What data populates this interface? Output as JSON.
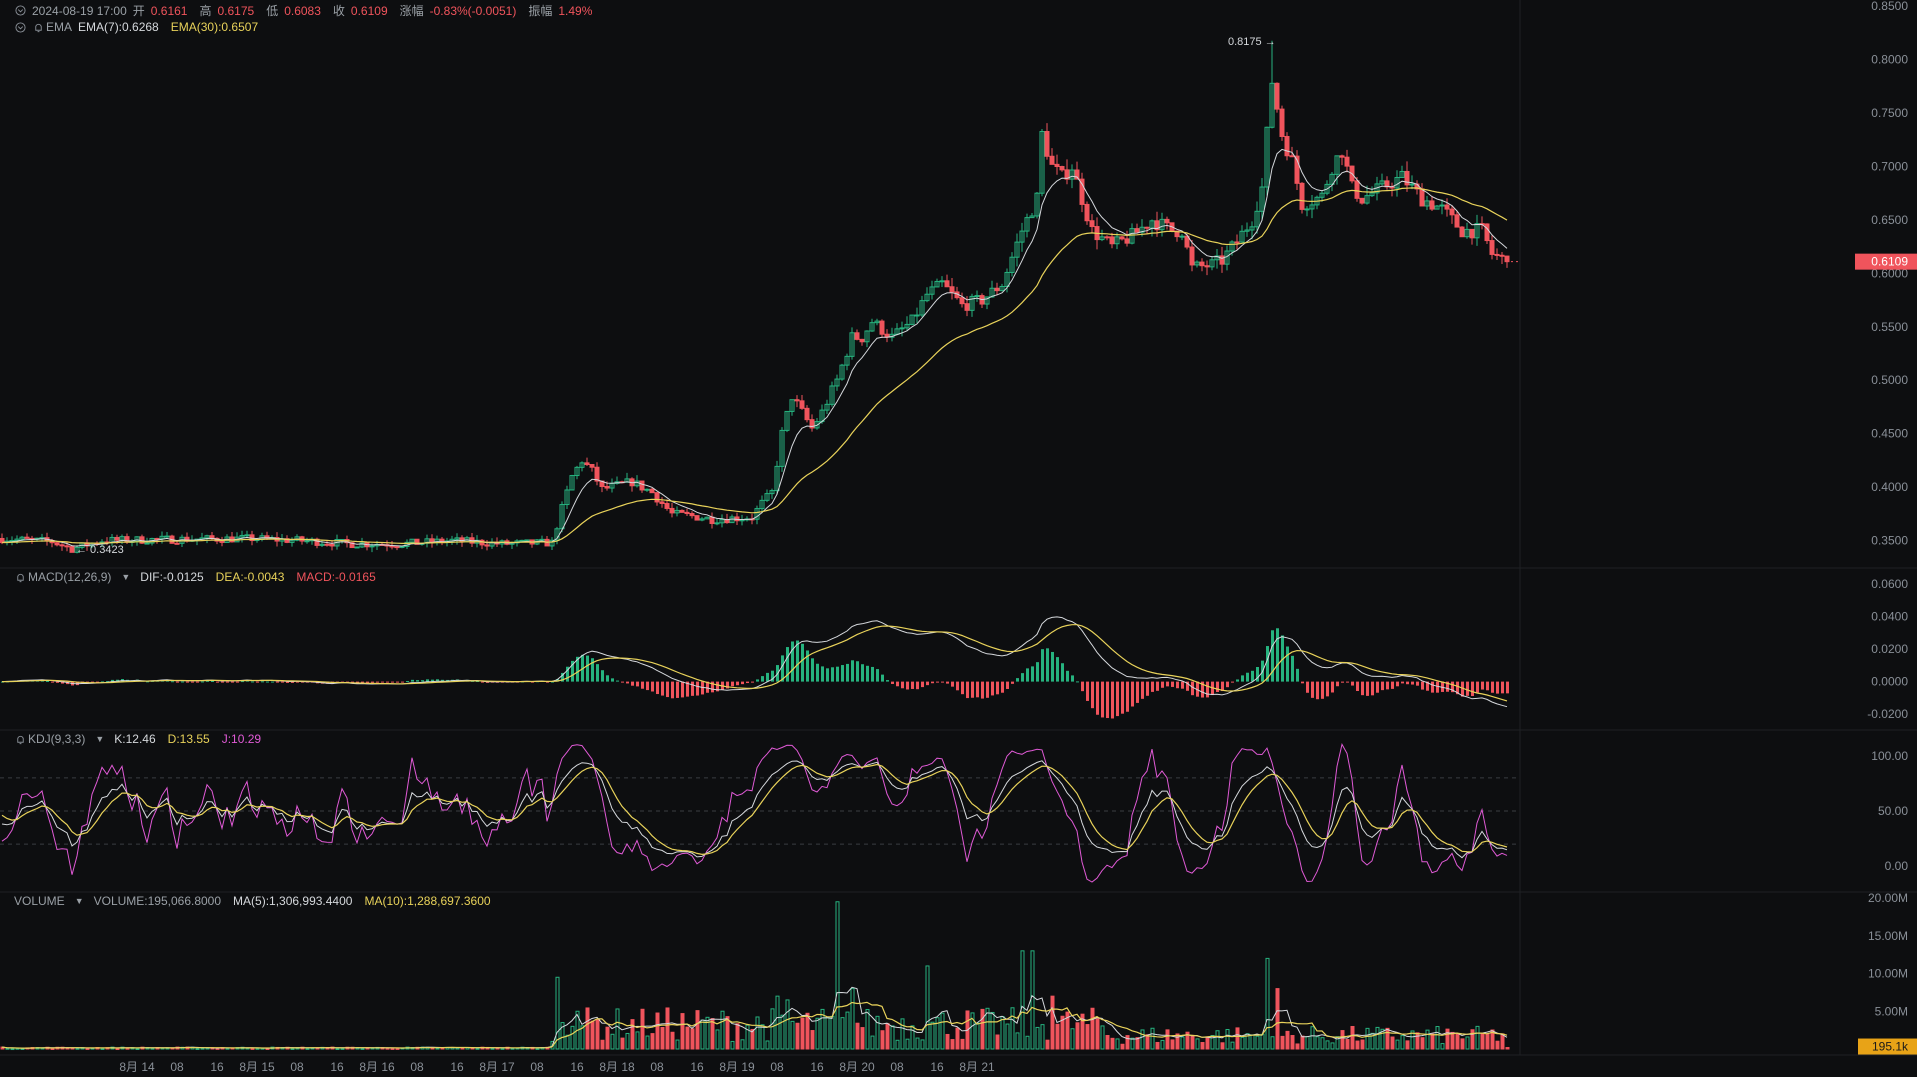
{
  "header": {
    "datetime": "2024-08-19 17:00",
    "open_label": "开",
    "open": "0.6161",
    "high_label": "高",
    "high": "0.6175",
    "low_label": "低",
    "low": "0.6083",
    "close_label": "收",
    "close": "0.6109",
    "change_label": "涨幅",
    "change": "-0.83%(-0.0051)",
    "amplitude_label": "振幅",
    "amplitude": "1.49%"
  },
  "ema_legend": {
    "name": "EMA",
    "ema7": "EMA(7):0.6268",
    "ema30": "EMA(30):0.6507"
  },
  "macd_legend": {
    "name": "MACD(12,26,9)",
    "dif": "DIF:-0.0125",
    "dea": "DEA:-0.0043",
    "macd": "MACD:-0.0165"
  },
  "kdj_legend": {
    "name": "KDJ(9,3,3)",
    "k": "K:12.46",
    "d": "D:13.55",
    "j": "J:10.29"
  },
  "volume_legend": {
    "name": "VOLUME",
    "volume": "VOLUME:195,066.8000",
    "ma5": "MA(5):1,306,993.4400",
    "ma10": "MA(10):1,288,697.3600"
  },
  "colors": {
    "up": "#26b37f",
    "down": "#f0545c",
    "ema7": "#d5d8dc",
    "ema30": "#e8d25a",
    "j": "#e05ad6",
    "bg": "#0d0e10",
    "grid": "#1c1e22"
  },
  "chart_data": {
    "type": "candlestick",
    "interval_hours": 1,
    "x_ticks": [
      "8月 14",
      "08",
      "16",
      "8月 15",
      "08",
      "16",
      "8月 16",
      "08",
      "16",
      "8月 17",
      "08",
      "16",
      "8月 18",
      "08",
      "16",
      "8月 19",
      "08",
      "16",
      "8月 20",
      "08",
      "16",
      "8月 21"
    ],
    "price_axis": {
      "ylim": [
        0.33,
        0.85
      ],
      "ticks": [
        0.35,
        0.4,
        0.45,
        0.5,
        0.55,
        0.6,
        0.65,
        0.7,
        0.75,
        0.8,
        0.85
      ],
      "tick_labels": [
        "0.3500",
        "0.4000",
        "0.4500",
        "0.5000",
        "0.5500",
        "0.6000",
        "0.6500",
        "0.7000",
        "0.7500",
        "0.8000",
        "0.8500"
      ],
      "last_price_label": "0.6109",
      "last_price": 0.6109
    },
    "annotations": {
      "max_label": "0.8175 →",
      "max": 0.8175,
      "min_label": "← 0.3423",
      "min": 0.3423
    },
    "price_path": [
      [
        0,
        0.352
      ],
      [
        10,
        0.349
      ],
      [
        14,
        0.3423
      ],
      [
        20,
        0.35
      ],
      [
        30,
        0.351
      ],
      [
        50,
        0.352
      ],
      [
        60,
        0.35
      ],
      [
        70,
        0.347
      ],
      [
        80,
        0.347
      ],
      [
        90,
        0.35
      ],
      [
        100,
        0.347
      ],
      [
        110,
        0.348
      ],
      [
        112,
        0.38
      ],
      [
        114,
        0.41
      ],
      [
        116,
        0.425
      ],
      [
        118,
        0.415
      ],
      [
        120,
        0.398
      ],
      [
        126,
        0.405
      ],
      [
        130,
        0.395
      ],
      [
        134,
        0.375
      ],
      [
        138,
        0.373
      ],
      [
        142,
        0.37
      ],
      [
        150,
        0.372
      ],
      [
        152,
        0.385
      ],
      [
        154,
        0.395
      ],
      [
        156,
        0.45
      ],
      [
        158,
        0.485
      ],
      [
        160,
        0.47
      ],
      [
        162,
        0.455
      ],
      [
        164,
        0.47
      ],
      [
        167,
        0.5
      ],
      [
        170,
        0.54
      ],
      [
        172,
        0.54
      ],
      [
        174,
        0.555
      ],
      [
        178,
        0.54
      ],
      [
        182,
        0.555
      ],
      [
        185,
        0.58
      ],
      [
        188,
        0.59
      ],
      [
        192,
        0.57
      ],
      [
        196,
        0.575
      ],
      [
        200,
        0.59
      ],
      [
        204,
        0.64
      ],
      [
        207,
        0.67
      ],
      [
        208,
        0.73
      ],
      [
        210,
        0.7
      ],
      [
        212,
        0.69
      ],
      [
        214,
        0.7
      ],
      [
        216,
        0.67
      ],
      [
        218,
        0.64
      ],
      [
        222,
        0.625
      ],
      [
        226,
        0.635
      ],
      [
        230,
        0.65
      ],
      [
        234,
        0.64
      ],
      [
        236,
        0.64
      ],
      [
        238,
        0.605
      ],
      [
        242,
        0.608
      ],
      [
        244,
        0.612
      ],
      [
        247,
        0.63
      ],
      [
        250,
        0.65
      ],
      [
        252,
        0.68
      ],
      [
        254,
        0.78
      ],
      [
        256,
        0.73
      ],
      [
        258,
        0.705
      ],
      [
        260,
        0.665
      ],
      [
        264,
        0.672
      ],
      [
        266,
        0.7
      ],
      [
        268,
        0.715
      ],
      [
        270,
        0.68
      ],
      [
        272,
        0.67
      ],
      [
        276,
        0.68
      ],
      [
        280,
        0.69
      ],
      [
        284,
        0.67
      ],
      [
        288,
        0.66
      ],
      [
        292,
        0.64
      ],
      [
        296,
        0.64
      ],
      [
        298,
        0.618
      ],
      [
        301,
        0.6109
      ]
    ],
    "ema7": "computed from price_path",
    "ema30": "computed from price_path",
    "macd_axis": {
      "ylim": [
        -0.026,
        0.066
      ],
      "ticks": [
        -0.02,
        0,
        0.02,
        0.04,
        0.06
      ],
      "tick_labels": [
        "-0.0200",
        "0.0000",
        "0.0200",
        "0.0400",
        "0.0600"
      ]
    },
    "kdj_axis": {
      "ylim": [
        -18,
        118
      ],
      "ticks": [
        0,
        50,
        100
      ],
      "tick_labels": [
        "0.00",
        "50.00",
        "100.00"
      ],
      "dashed_levels": [
        20,
        50,
        80
      ]
    },
    "volume_axis": {
      "ylim": [
        0,
        20000000
      ],
      "ticks": [
        5000000,
        10000000,
        15000000,
        20000000
      ],
      "tick_labels": [
        "5.00M",
        "10.00M",
        "15.00M",
        "20.00M"
      ],
      "last_volume_label": "195.1k",
      "last_volume": 195066.8
    },
    "volume_spikes": [
      [
        111,
        9500000
      ],
      [
        112,
        3500000
      ],
      [
        114,
        3000000
      ],
      [
        115,
        5000000
      ],
      [
        155,
        7000000
      ],
      [
        157,
        6500000
      ],
      [
        167,
        19500000
      ],
      [
        170,
        8000000
      ],
      [
        185,
        11000000
      ],
      [
        204,
        13000000
      ],
      [
        206,
        13000000
      ],
      [
        210,
        7000000
      ],
      [
        253,
        12000000
      ],
      [
        255,
        8000000
      ]
    ]
  }
}
